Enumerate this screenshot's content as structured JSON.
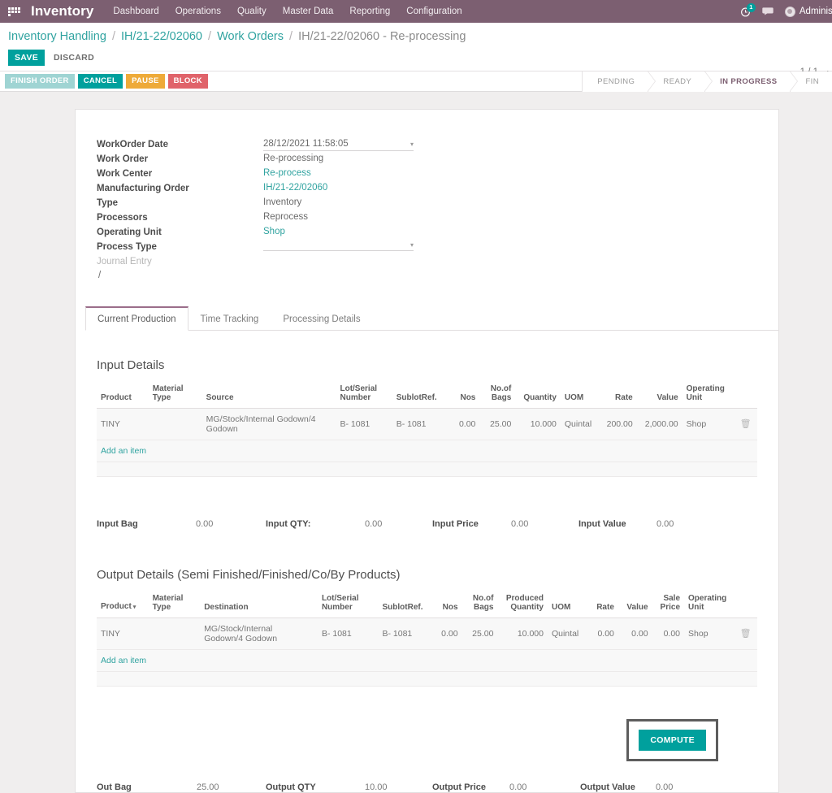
{
  "navbar": {
    "apps_icon": "grid-apps-icon",
    "brand": "Inventory",
    "menu": [
      "Dashboard",
      "Operations",
      "Quality",
      "Master Data",
      "Reporting",
      "Configuration"
    ],
    "activity_icon": "clock-activity-icon",
    "activity_count": "1",
    "messages_icon": "chat-bubble-icon",
    "user_name": "Administ",
    "avatar_icon": "user-avatar-icon"
  },
  "breadcrumb": {
    "items": [
      "Inventory Handling",
      "IH/21-22/02060",
      "Work Orders"
    ],
    "current": "IH/21-22/02060 - Re-processing",
    "separator": "/"
  },
  "control_panel": {
    "save_label": "SAVE",
    "discard_label": "DISCARD",
    "pager": "1 / 1",
    "prev_icon": "chevron-left-icon",
    "next_icon": "chevron-right-icon"
  },
  "action_buttons": [
    {
      "label": "FINISH ORDER",
      "style": "finish"
    },
    {
      "label": "CANCEL",
      "style": "cancel"
    },
    {
      "label": "PAUSE",
      "style": "pause"
    },
    {
      "label": "BLOCK",
      "style": "block"
    }
  ],
  "status_flow": {
    "stages": [
      "PENDING",
      "READY",
      "IN PROGRESS",
      "FIN"
    ],
    "active": "IN PROGRESS"
  },
  "form": {
    "fields": [
      {
        "label": "WorkOrder Date",
        "value": "28/12/2021 11:58:05",
        "type": "datetime",
        "caret": "▾"
      },
      {
        "label": "Work Order",
        "value": "Re-processing",
        "type": "text"
      },
      {
        "label": "Work Center",
        "value": "Re-process",
        "type": "link"
      },
      {
        "label": "Manufacturing Order",
        "value": "IH/21-22/02060",
        "type": "link"
      },
      {
        "label": "Type",
        "value": "Inventory",
        "type": "text"
      },
      {
        "label": "Processors",
        "value": "Reprocess",
        "type": "text"
      },
      {
        "label": "Operating Unit",
        "value": "Shop",
        "type": "link"
      },
      {
        "label": "Process Type",
        "value": "",
        "type": "select",
        "caret": "▾"
      },
      {
        "label": "Journal Entry",
        "value": "",
        "type": "muted"
      }
    ],
    "journal_slash": "/"
  },
  "tabs": [
    {
      "label": "Current Production",
      "active": true
    },
    {
      "label": "Time Tracking",
      "active": false
    },
    {
      "label": "Processing Details",
      "active": false
    }
  ],
  "input_section": {
    "title": "Input Details",
    "columns": [
      "Product",
      "Material Type",
      "Source",
      "Lot/Serial Number",
      "SublotRef.",
      "Nos",
      "No.of Bags",
      "Quantity",
      "UOM",
      "Rate",
      "Value",
      "Operating Unit"
    ],
    "rows": [
      {
        "product": "TINY",
        "material_type": "",
        "source": "MG/Stock/Internal Godown/4 Godown",
        "lot_serial": "B- 1081",
        "sublot_ref": "B- 1081",
        "nos": "0.00",
        "bags": "25.00",
        "quantity": "10.000",
        "uom": "Quintal",
        "rate": "200.00",
        "value": "2,000.00",
        "operating_unit": "Shop",
        "delete_icon": "trash-icon"
      }
    ],
    "add_item_label": "Add an item",
    "totals": [
      {
        "label": "Input Bag",
        "value": "0.00"
      },
      {
        "label": "Input QTY:",
        "value": "0.00"
      },
      {
        "label": "Input Price",
        "value": "0.00"
      },
      {
        "label": "Input Value",
        "value": "0.00"
      }
    ]
  },
  "output_section": {
    "title": "Output Details (Semi Finished/Finished/Co/By Products)",
    "columns": [
      "Product",
      "Material Type",
      "Destination",
      "Lot/Serial Number",
      "SublotRef.",
      "Nos",
      "No.of Bags",
      "Produced Quantity",
      "UOM",
      "Rate",
      "Value",
      "Sale Price",
      "Operating Unit"
    ],
    "product_sort_icon": "▾",
    "rows": [
      {
        "product": "TINY",
        "material_type": "",
        "destination": "MG/Stock/Internal Godown/4 Godown",
        "lot_serial": "B- 1081",
        "sublot_ref": "B- 1081",
        "nos": "0.00",
        "bags": "25.00",
        "produced_quantity": "10.000",
        "uom": "Quintal",
        "rate": "0.00",
        "value": "0.00",
        "sale_price": "0.00",
        "operating_unit": "Shop",
        "delete_icon": "trash-icon"
      }
    ],
    "add_item_label": "Add an item",
    "compute_label": "COMPUTE",
    "totals": [
      {
        "label": "Out Bag",
        "value": "25.00"
      },
      {
        "label": "Output QTY",
        "value": "10.00"
      },
      {
        "label": "Output Price",
        "value": "0.00"
      },
      {
        "label": "Output Value",
        "value": "0.00"
      }
    ]
  },
  "colors": {
    "navbar": "#7c5f71",
    "accent_teal": "#00a09d",
    "link_teal": "#30a3a0",
    "pause_orange": "#eeaa39",
    "block_red": "#e0636a",
    "active_stage": "#7c5f71"
  }
}
